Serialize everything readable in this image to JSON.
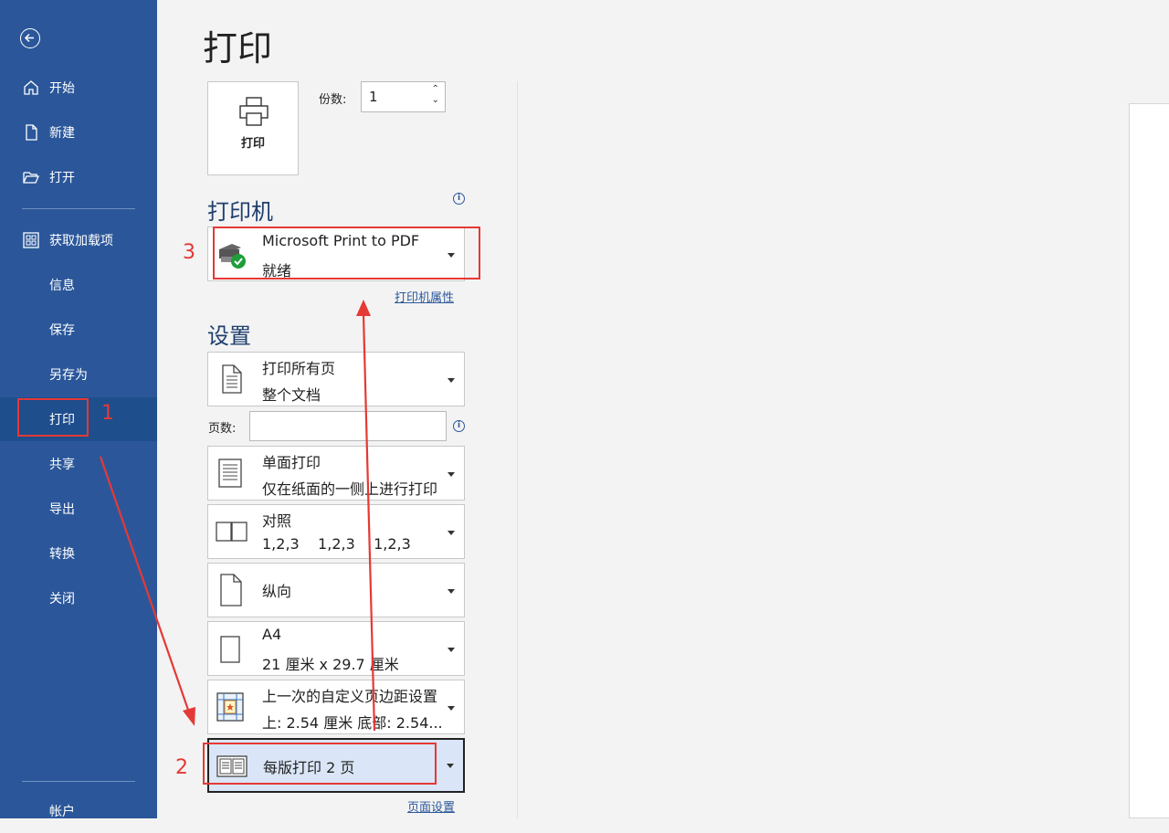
{
  "sidebar": {
    "items": [
      {
        "label": "开始"
      },
      {
        "label": "新建"
      },
      {
        "label": "打开"
      },
      {
        "label": "获取加载项"
      },
      {
        "label": "信息"
      },
      {
        "label": "保存"
      },
      {
        "label": "另存为"
      },
      {
        "label": "打印"
      },
      {
        "label": "共享"
      },
      {
        "label": "导出"
      },
      {
        "label": "转换"
      },
      {
        "label": "关闭"
      },
      {
        "label": "帐户"
      }
    ],
    "active": "打印"
  },
  "main": {
    "title": "打印",
    "print_button": {
      "label": "打印"
    },
    "copies": {
      "label": "份数:",
      "value": "1"
    },
    "printer_section": {
      "heading": "打印机",
      "printer": {
        "name": "Microsoft Print to PDF",
        "status": "就绪"
      },
      "properties_link": "打印机属性"
    },
    "settings_section": {
      "heading": "设置",
      "pages_label": "页数:",
      "pages_value": "",
      "options": [
        {
          "line1": "打印所有页",
          "line2": "整个文档"
        },
        {
          "line1": "单面打印",
          "line2": "仅在纸面的一侧上进行打印"
        },
        {
          "line1": "对照",
          "line2": "1,2,3    1,2,3    1,2,3"
        },
        {
          "line1": "纵向",
          "line2": ""
        },
        {
          "line1": "A4",
          "line2": "21 厘米 x 29.7 厘米"
        },
        {
          "line1": "上一次的自定义页边距设置",
          "line2": "上: 2.54 厘米 底部: 2.54..."
        },
        {
          "line1": "每版打印 2 页",
          "line2": ""
        }
      ],
      "page_setup_link": "页面设置"
    }
  },
  "annotations": {
    "n1": "1",
    "n2": "2",
    "n3": "3"
  },
  "colors": {
    "sidebar": "#2b579a",
    "annotation": "#e53935",
    "selected": "#dae6f7"
  }
}
